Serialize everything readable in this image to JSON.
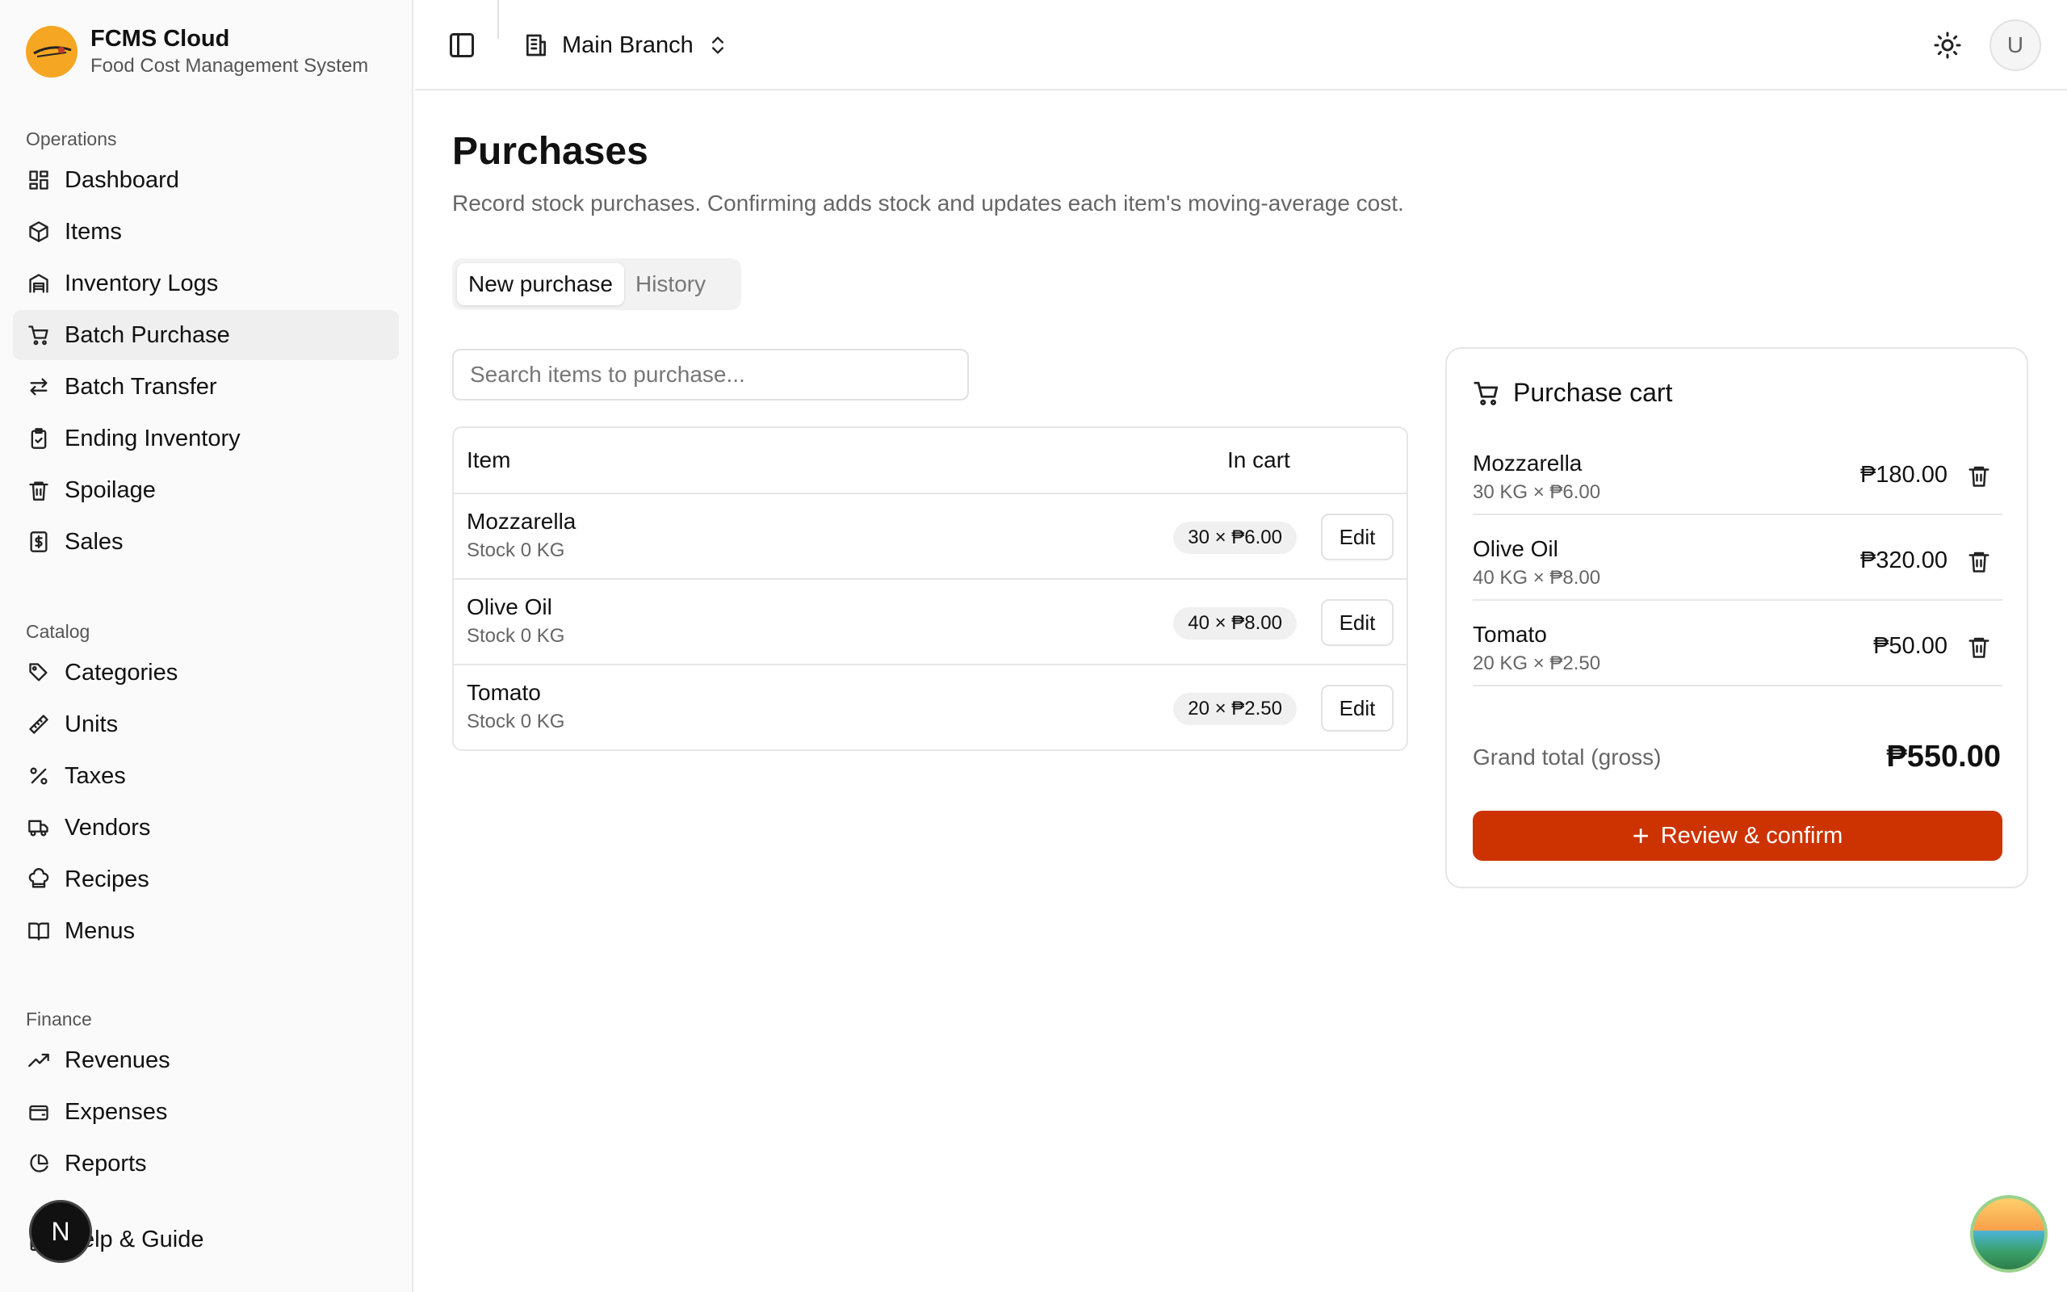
{
  "brand": {
    "title": "FCMS Cloud",
    "subtitle": "Food Cost Management System"
  },
  "sidebar": {
    "groups": [
      {
        "label": "Operations",
        "items": [
          {
            "label": "Dashboard",
            "icon": "dashboard-icon"
          },
          {
            "label": "Items",
            "icon": "package-icon"
          },
          {
            "label": "Inventory Logs",
            "icon": "warehouse-icon"
          },
          {
            "label": "Batch Purchase",
            "icon": "cart-icon",
            "active": true
          },
          {
            "label": "Batch Transfer",
            "icon": "transfer-icon"
          },
          {
            "label": "Ending Inventory",
            "icon": "clipboard-check-icon"
          },
          {
            "label": "Spoilage",
            "icon": "trash-icon"
          },
          {
            "label": "Sales",
            "icon": "receipt-icon"
          }
        ]
      },
      {
        "label": "Catalog",
        "items": [
          {
            "label": "Categories",
            "icon": "tag-icon"
          },
          {
            "label": "Units",
            "icon": "ruler-icon"
          },
          {
            "label": "Taxes",
            "icon": "percent-icon"
          },
          {
            "label": "Vendors",
            "icon": "truck-icon"
          },
          {
            "label": "Recipes",
            "icon": "chef-hat-icon"
          },
          {
            "label": "Menus",
            "icon": "book-open-icon"
          }
        ]
      },
      {
        "label": "Finance",
        "items": [
          {
            "label": "Revenues",
            "icon": "trending-up-icon"
          },
          {
            "label": "Expenses",
            "icon": "wallet-icon"
          },
          {
            "label": "Reports",
            "icon": "pie-chart-icon"
          },
          {
            "label": "Help & Guide",
            "icon": "book-icon"
          }
        ]
      }
    ]
  },
  "header": {
    "branch": "Main Branch",
    "avatar_initial": "U"
  },
  "page": {
    "title": "Purchases",
    "description": "Record stock purchases. Confirming adds stock and updates each item's moving-average cost.",
    "tabs": [
      {
        "label": "New purchase",
        "active": true
      },
      {
        "label": "History",
        "active": false
      }
    ],
    "search_placeholder": "Search items to purchase..."
  },
  "table": {
    "headers": {
      "item": "Item",
      "in_cart": "In cart"
    },
    "rows": [
      {
        "name": "Mozzarella",
        "stock": "Stock 0 KG",
        "cart": "30 × ₱6.00",
        "action": "Edit"
      },
      {
        "name": "Olive Oil",
        "stock": "Stock 0 KG",
        "cart": "40 × ₱8.00",
        "action": "Edit"
      },
      {
        "name": "Tomato",
        "stock": "Stock 0 KG",
        "cart": "20 × ₱2.50",
        "action": "Edit"
      }
    ]
  },
  "cart": {
    "title": "Purchase cart",
    "items": [
      {
        "name": "Mozzarella",
        "detail": "30 KG × ₱6.00",
        "total": "₱180.00"
      },
      {
        "name": "Olive Oil",
        "detail": "40 KG × ₱8.00",
        "total": "₱320.00"
      },
      {
        "name": "Tomato",
        "detail": "20 KG × ₱2.50",
        "total": "₱50.00"
      }
    ],
    "grand_total_label": "Grand total (gross)",
    "grand_total": "₱550.00",
    "confirm_label": "Review & confirm"
  },
  "colors": {
    "accent": "#cc3300",
    "logo": "#f5a623"
  },
  "floating": {
    "dev_badge": "N"
  }
}
